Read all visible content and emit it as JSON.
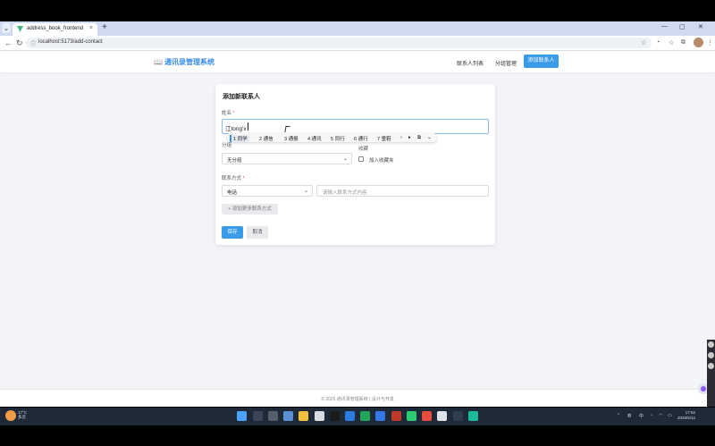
{
  "browser": {
    "tab_title": "address_book_frontend",
    "url": "localhost:5173/add-contact"
  },
  "header": {
    "brand_icon": "📖",
    "brand": "通讯录管理系统",
    "nav": [
      "联系人列表",
      "分组管理"
    ],
    "nav_active": "添加联系人",
    "accent": "#3a9be8"
  },
  "form": {
    "title": "添加新联系人",
    "name_label": "姓名",
    "name_value": "江tong'x",
    "ime_candidates": [
      "1 同学",
      "2 通信",
      "3 通报",
      "4 通讯",
      "5 同行",
      "6 通行",
      "7 童鞋"
    ],
    "group_label": "分组",
    "group_value": "无分组",
    "favorite_label": "收藏",
    "favorite_checkbox_label": "加入收藏夹",
    "contact_label": "联系方式",
    "contact_type": "电话",
    "contact_placeholder": "请输入联系方式内容",
    "add_more": "+ 添加更多联系方式",
    "save": "保存",
    "cancel": "取消"
  },
  "footer": {
    "text": "© 2025 通讯录管理系统 | 设计与开发"
  },
  "taskbar": {
    "weather_temp": "17°C",
    "weather_desc": "多云",
    "ime_indicator": "中",
    "time": "17:52",
    "date": "2025/5/12"
  }
}
